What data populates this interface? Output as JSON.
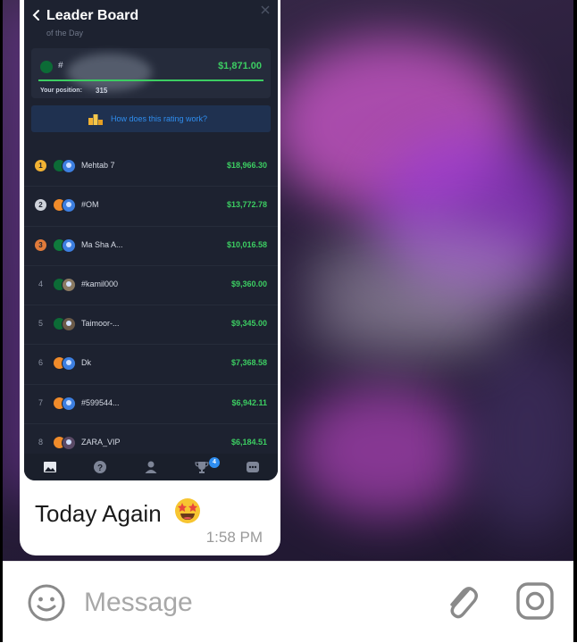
{
  "leaderboard": {
    "title": "Leader Board",
    "subtitle": "of the Day",
    "my_position": {
      "prefix": "#",
      "amount": "$1,871.00",
      "label": "Your position:",
      "value": "315"
    },
    "rating_link": "How does this rating work?",
    "rows": [
      {
        "rank": "1",
        "name": "Mehtab 7",
        "amount": "$18,966.30"
      },
      {
        "rank": "2",
        "name": "#OM",
        "amount": "$13,772.78"
      },
      {
        "rank": "3",
        "name": "Ma Sha A...",
        "amount": "$10,016.58"
      },
      {
        "rank": "4",
        "name": "#kamil000",
        "amount": "$9,360.00"
      },
      {
        "rank": "5",
        "name": "Taimoor-...",
        "amount": "$9,345.00"
      },
      {
        "rank": "6",
        "name": "Dk",
        "amount": "$7,368.58"
      },
      {
        "rank": "7",
        "name": "#599544...",
        "amount": "$6,942.11"
      },
      {
        "rank": "8",
        "name": "ZARA_VIP",
        "amount": "$6,184.51"
      }
    ],
    "tabs": [
      {
        "icon": "image-icon"
      },
      {
        "icon": "help-icon"
      },
      {
        "icon": "user-icon"
      },
      {
        "icon": "trophy-icon",
        "badge": "4"
      },
      {
        "icon": "more-icon"
      }
    ]
  },
  "message": {
    "caption": "Today Again",
    "time": "1:58 PM"
  },
  "composer": {
    "placeholder": "Message"
  },
  "colors": {
    "green": "#3ccd62",
    "link_blue": "#2f8ef0",
    "panel_bg": "#1d2230"
  }
}
